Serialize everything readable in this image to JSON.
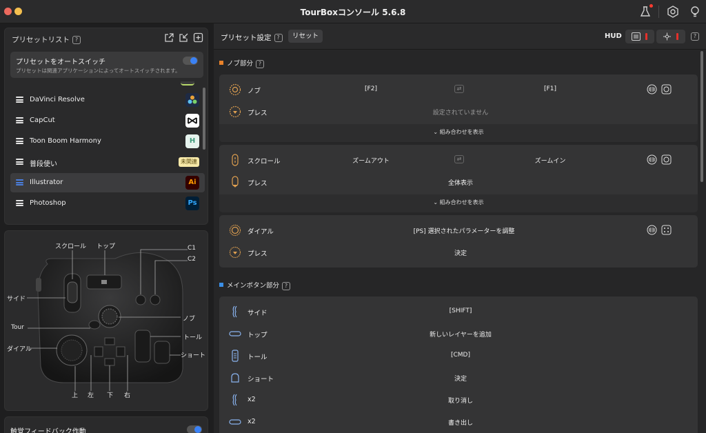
{
  "window": {
    "title": "TourBoxコンソール 5.6.8"
  },
  "preset_list": {
    "heading": "プリセットリスト",
    "help": "?",
    "auto_switch": {
      "title": "プリセットをオートスイッチ",
      "description": "プリセットは関連アプリケーションによってオートスイッチされます。",
      "enabled": true
    },
    "items": [
      {
        "name": "DaVinci Resolve",
        "icon": "davinci-resolve-icon"
      },
      {
        "name": "CapCut",
        "icon": "capcut-icon"
      },
      {
        "name": "Toon Boom Harmony",
        "icon": "harmony-icon",
        "icon_text": "H"
      },
      {
        "name": "普段使い",
        "badge": "未関連"
      },
      {
        "name": "Illustrator",
        "icon": "illustrator-icon",
        "icon_text": "Ai",
        "selected": true
      },
      {
        "name": "Photoshop",
        "icon": "photoshop-icon",
        "icon_text": "Ps"
      }
    ]
  },
  "device": {
    "labels": {
      "scroll": "スクロール",
      "top": "トップ",
      "c1": "C1",
      "c2": "C2",
      "side": "サイド",
      "knob": "ノブ",
      "tour": "Tour",
      "tall": "トール",
      "dial": "ダイアル",
      "short": "ショート",
      "up": "上",
      "left": "左",
      "down": "下",
      "right": "右"
    }
  },
  "haptic": {
    "label": "触覚フィードバック作動",
    "enabled": true
  },
  "preset_settings": {
    "heading": "プリセット設定",
    "help": "?",
    "reset": "リセット",
    "hud": "HUD"
  },
  "knob_section": {
    "title": "ノブ部分",
    "help": "?",
    "accent": "#e8822a",
    "show_combo": "組み合わせを表示",
    "knob": {
      "name": "ノブ",
      "left": "[F2]",
      "right": "[F1]"
    },
    "knob_press": {
      "name": "プレス",
      "value": "設定されていません"
    },
    "scroll": {
      "name": "スクロール",
      "left": "ズームアウト",
      "right": "ズームイン"
    },
    "scroll_press": {
      "name": "プレス",
      "value": "全体表示"
    },
    "dial": {
      "name": "ダイアル",
      "value": "[PS] 選択されたパラメーターを調整"
    },
    "dial_press": {
      "name": "プレス",
      "value": "決定"
    }
  },
  "main_section": {
    "title": "メインボタン部分",
    "help": "?",
    "accent": "#3a8ee6",
    "rows": [
      {
        "name": "サイド",
        "value": "[SHIFT]",
        "icon": "side-button-icon"
      },
      {
        "name": "トップ",
        "value": "新しいレイヤーを追加",
        "icon": "top-button-icon"
      },
      {
        "name": "トール",
        "value": "[CMD]",
        "icon": "tall-button-icon"
      },
      {
        "name": "ショート",
        "value": "決定",
        "icon": "short-button-icon"
      },
      {
        "name": "x2",
        "value": "取り消し",
        "icon": "side-button-icon"
      },
      {
        "name": "x2",
        "value": "書き出し",
        "icon": "top-button-icon"
      }
    ]
  }
}
